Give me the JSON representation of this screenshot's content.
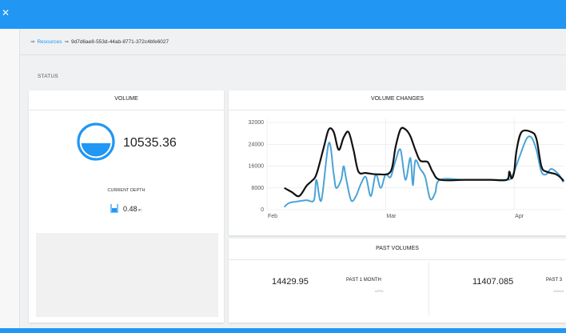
{
  "header": {
    "menu_icon": "close-icon"
  },
  "breadcrumb": {
    "separator": "⇒",
    "resources": "Resources",
    "resource_id": "9d7d6ae8-553d-44ab-8771-372c4bfe6027"
  },
  "section_title": "STATUS",
  "volume_card": {
    "title": "VOLUME",
    "value": "10535.36",
    "fill_fraction": 0.45,
    "depth_label": "CURRENT DEPTH",
    "depth_value": "0.48",
    "depth_unit": "m"
  },
  "changes_card": {
    "title": "VOLUME CHANGES"
  },
  "past_card": {
    "title": "PAST VOLUMES",
    "items": [
      {
        "value": "14429.95",
        "label": "PAST 1 MONTH",
        "sublabel": "APRIL"
      },
      {
        "value": "11407.085",
        "label": "PAST 3",
        "sublabel": "JANUA"
      }
    ]
  },
  "colors": {
    "accent": "#2196f3",
    "series_dark": "#111111",
    "series_blue": "#4aa3d8"
  },
  "chart_data": {
    "type": "line",
    "title": "VOLUME CHANGES",
    "yticks": [
      0,
      8000,
      16000,
      24000,
      32000
    ],
    "ytick_labels": [
      "0",
      "8000",
      "16000",
      "24000",
      "32000"
    ],
    "ylim": [
      0,
      33500
    ],
    "xlim": [
      0,
      120
    ],
    "xticks": [
      {
        "x": 0,
        "label": "Feb"
      },
      {
        "x": 48,
        "label": "Mar"
      },
      {
        "x": 100,
        "label": "Apr"
      }
    ],
    "grid": true,
    "series": [
      {
        "color": "#111111",
        "points": [
          [
            7,
            8000
          ],
          [
            10,
            6500
          ],
          [
            13,
            5000
          ],
          [
            16,
            8800
          ],
          [
            18,
            10500
          ],
          [
            20,
            13000
          ],
          [
            23,
            23000
          ],
          [
            25,
            29500
          ],
          [
            27,
            28500
          ],
          [
            29,
            22000
          ],
          [
            31,
            26500
          ],
          [
            33,
            28500
          ],
          [
            35,
            22000
          ],
          [
            37,
            14000
          ],
          [
            40,
            13500
          ],
          [
            45,
            13000
          ],
          [
            50,
            14000
          ],
          [
            52,
            23000
          ],
          [
            54,
            29500
          ],
          [
            56,
            29500
          ],
          [
            58,
            27000
          ],
          [
            60,
            22000
          ],
          [
            62,
            18000
          ],
          [
            65,
            17500
          ],
          [
            67,
            14000
          ],
          [
            70,
            11000
          ],
          [
            80,
            11000
          ],
          [
            90,
            11000
          ],
          [
            97,
            11000
          ],
          [
            98,
            14000
          ],
          [
            99,
            11500
          ],
          [
            100,
            14000
          ],
          [
            101,
            22000
          ],
          [
            103,
            28500
          ],
          [
            107,
            28500
          ],
          [
            109,
            26000
          ],
          [
            111,
            16000
          ],
          [
            113,
            14000
          ],
          [
            117,
            13000
          ],
          [
            120,
            11000
          ],
          [
            123,
            10500
          ]
        ]
      },
      {
        "color": "#4aa3d8",
        "points": [
          [
            7,
            1000
          ],
          [
            9,
            2500
          ],
          [
            12,
            3000
          ],
          [
            16,
            3500
          ],
          [
            19,
            3500
          ],
          [
            20,
            11000
          ],
          [
            22,
            3500
          ],
          [
            25,
            24500
          ],
          [
            27,
            13000
          ],
          [
            28,
            8000
          ],
          [
            30,
            11000
          ],
          [
            31,
            16000
          ],
          [
            32,
            11500
          ],
          [
            34,
            3500
          ],
          [
            36,
            5000
          ],
          [
            38,
            9500
          ],
          [
            40,
            12000
          ],
          [
            42,
            5000
          ],
          [
            44,
            13000
          ],
          [
            46,
            8000
          ],
          [
            48,
            13000
          ],
          [
            50,
            12000
          ],
          [
            52,
            18000
          ],
          [
            54,
            22000
          ],
          [
            56,
            11000
          ],
          [
            58,
            19000
          ],
          [
            59,
            9000
          ],
          [
            60,
            18000
          ],
          [
            62,
            15000
          ],
          [
            64,
            12000
          ],
          [
            66,
            4000
          ],
          [
            68,
            6000
          ],
          [
            70,
            11000
          ],
          [
            80,
            11000
          ],
          [
            90,
            11000
          ],
          [
            97,
            11000
          ],
          [
            99,
            12000
          ],
          [
            102,
            19000
          ],
          [
            105,
            26000
          ],
          [
            107,
            26500
          ],
          [
            109,
            22000
          ],
          [
            111,
            14000
          ],
          [
            113,
            13000
          ],
          [
            115,
            15000
          ],
          [
            118,
            13000
          ],
          [
            121,
            10500
          ],
          [
            123,
            10500
          ]
        ]
      }
    ]
  }
}
